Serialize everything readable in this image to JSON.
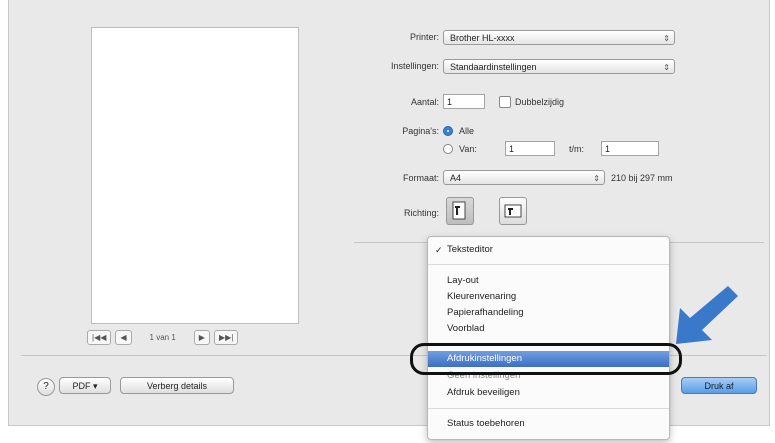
{
  "printer": {
    "label": "Printer:",
    "value": "Brother HL-xxxx"
  },
  "presets": {
    "label": "Instellingen:",
    "value": "Standaardinstellingen"
  },
  "copies": {
    "label": "Aantal:",
    "value": "1",
    "duplex_label": "Dubbelzijdig"
  },
  "pages": {
    "label": "Pagina's:",
    "all_label": "Alle",
    "from_label": "Van:",
    "from_value": "1",
    "to_label": "t/m:",
    "to_value": "1"
  },
  "paper": {
    "label": "Formaat:",
    "value": "A4",
    "size_text": "210 bij 297 mm"
  },
  "orientation": {
    "label": "Richting:"
  },
  "pager": {
    "first": "|◀◀",
    "prev": "◀",
    "page_text": "1 van 1",
    "next": "▶",
    "last": "▶▶|"
  },
  "bottom": {
    "help": "?",
    "pdf": "PDF",
    "pdf_arrow": "▾",
    "hide_details": "Verberg details",
    "print": "Druk af"
  },
  "menu": {
    "checked": "Teksteditor",
    "items": [
      "Lay-out",
      "Kleurenvenaring",
      "Papierafhandeling",
      "Voorblad"
    ],
    "highlighted": "Afdrukinstellingen",
    "items2": [
      "Geen instellingen",
      "Afdruk beveiligen"
    ],
    "last": "Status toebehoren"
  },
  "colors": {
    "accent": "#3d73c6",
    "arrow": "#3a78c9"
  }
}
